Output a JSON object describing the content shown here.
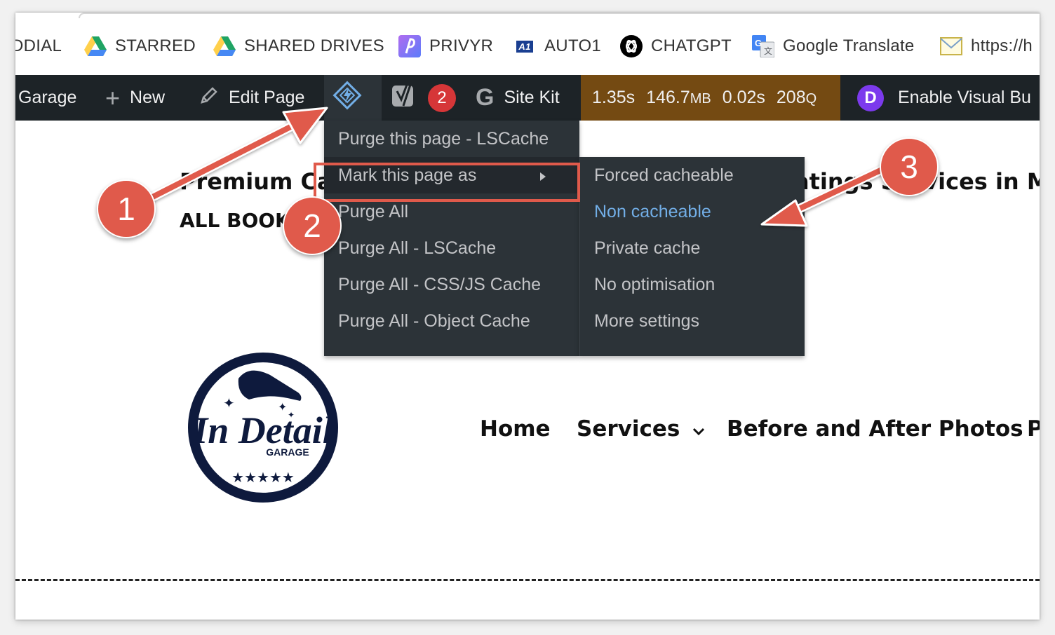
{
  "bookmarks": [
    {
      "label": "DDIAL",
      "icon": "none"
    },
    {
      "label": "STARRED",
      "icon": "google-drive-icon"
    },
    {
      "label": "SHARED DRIVES",
      "icon": "google-drive-icon"
    },
    {
      "label": "PRIVYR",
      "icon": "privyr-icon"
    },
    {
      "label": "AUTO1",
      "icon": "auto1-icon",
      "icon_text": "A1"
    },
    {
      "label": "CHATGPT",
      "icon": "openai-icon"
    },
    {
      "label": "Google Translate",
      "icon": "google-translate-icon"
    },
    {
      "label": "https://h",
      "icon": "mail-icon"
    }
  ],
  "adminbar": {
    "site_name": "Garage",
    "new_label": "New",
    "edit_label": "Edit Page",
    "yoast_badge": "2",
    "sitekit_label": "Site Kit",
    "perf": {
      "time1": "1.35s",
      "memory": "146.7",
      "memory_unit": "MB",
      "time2": "0.02s",
      "queries": "208",
      "queries_unit": "Q"
    },
    "divi_letter": "D",
    "divi_label": "Enable Visual Bu"
  },
  "menu": {
    "items": [
      "Purge this page - LSCache",
      "Mark this page as",
      "Purge All",
      "Purge All - LSCache",
      "Purge All - CSS/JS Cache",
      "Purge All - Object Cache"
    ],
    "submenu": [
      "Forced cacheable",
      "Non cacheable",
      "Private cache",
      "No optimisation",
      "More settings"
    ]
  },
  "page": {
    "heading_left": "Premium Ca",
    "heading_right": "atings Services in M",
    "subheading": "ALL BOOK",
    "logo_text_main": "In Detail",
    "logo_text_sub": "GARAGE",
    "nav": [
      "Home",
      "Services",
      "Before and After Photos",
      "P"
    ]
  },
  "annotations": [
    "1",
    "2",
    "3"
  ],
  "colors": {
    "annotation": "#e05a4b",
    "adminbar": "#1d2327",
    "menu": "#2c3338",
    "highlight": "#72aee6",
    "perf": "#744a12"
  }
}
